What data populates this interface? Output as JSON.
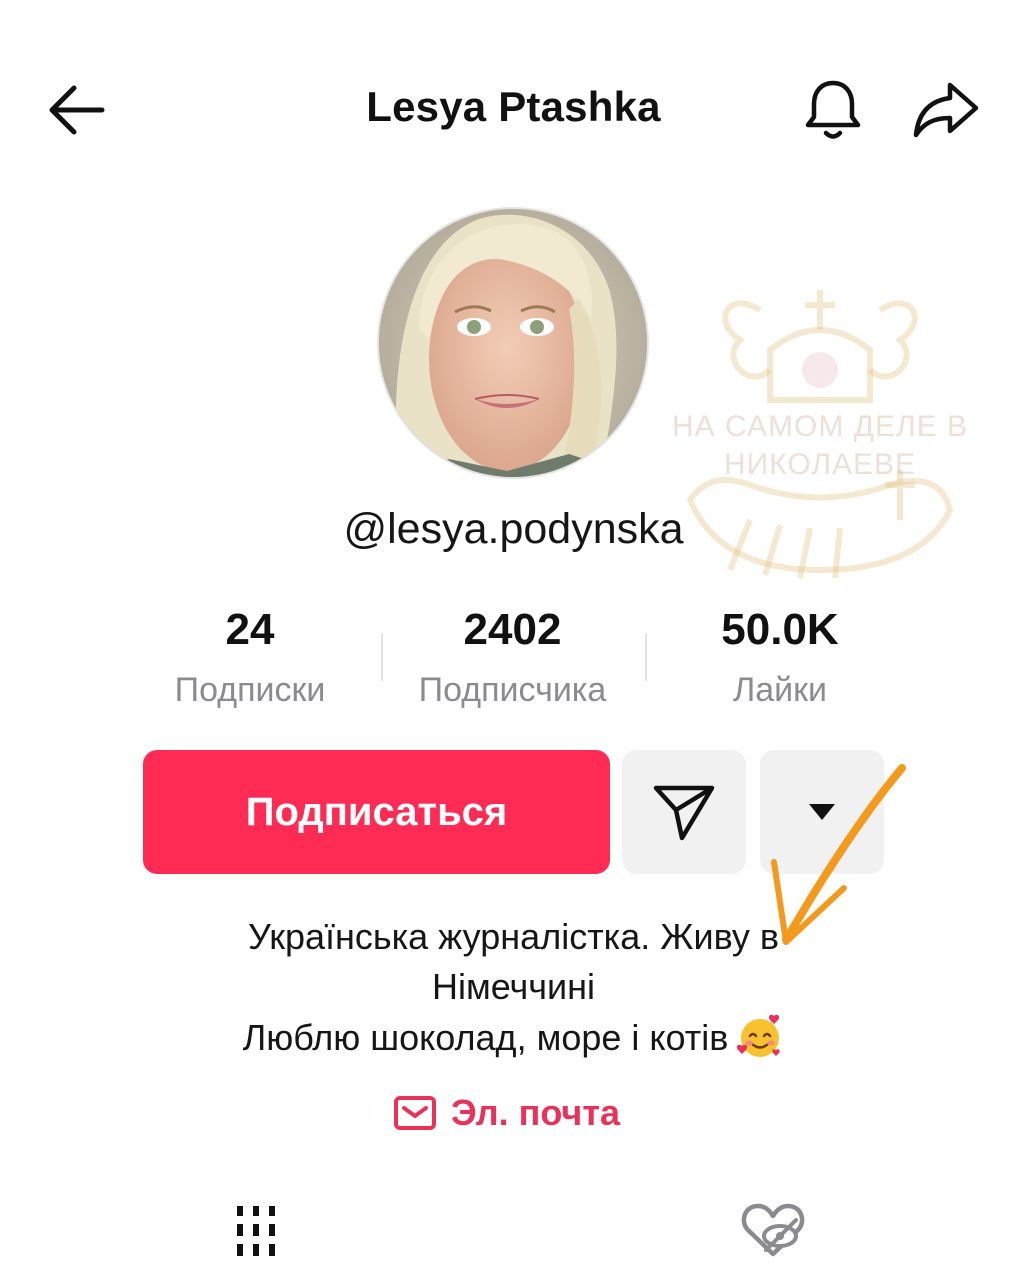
{
  "header": {
    "title": "Lesya Ptashka",
    "back_icon": "arrow-left-icon",
    "bell_icon": "bell-icon",
    "share_icon": "share-arrow-icon"
  },
  "profile": {
    "username": "@lesya.podynska",
    "avatar_alt": "profile photo"
  },
  "stats": [
    {
      "value": "24",
      "label": "Подписки"
    },
    {
      "value": "2402",
      "label": "Подписчика"
    },
    {
      "value": "50.0K",
      "label": "Лайки"
    }
  ],
  "actions": {
    "follow_label": "Подписаться",
    "message_icon": "send-message-icon",
    "more_icon": "caret-down-icon"
  },
  "bio": {
    "line1": "Українська журналістка. Живу в",
    "line2": "Німеччині",
    "line3": "Люблю шоколад, море і котів",
    "emoji_icon": "smiling-face-with-hearts-icon"
  },
  "email": {
    "label": "Эл. почта",
    "icon": "envelope-icon"
  },
  "tabs": {
    "videos_icon": "grid-lines-icon",
    "liked_icon": "heart-hidden-icon"
  },
  "watermark": {
    "line1": "НА САМОМ ДЕЛЕ В",
    "line2": "НИКОЛАЕВЕ"
  },
  "colors": {
    "accent": "#fe2c55",
    "email": "#e8325a",
    "secondary_text": "#8a8a8f",
    "annotation_arrow": "#f39a1e"
  }
}
